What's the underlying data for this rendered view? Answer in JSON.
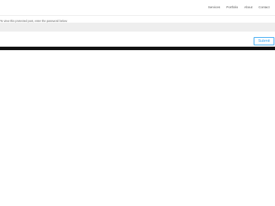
{
  "nav": {
    "items": [
      {
        "label": "Services"
      },
      {
        "label": "Portfolio"
      },
      {
        "label": "About"
      },
      {
        "label": "Contact"
      }
    ]
  },
  "form": {
    "notice": "To view this protected post, enter the password below:",
    "password_value": "",
    "submit_label": "Submit"
  },
  "colors": {
    "accent": "#2ea3f2",
    "field_background": "#eeeeee",
    "footer_bar": "#111111"
  }
}
